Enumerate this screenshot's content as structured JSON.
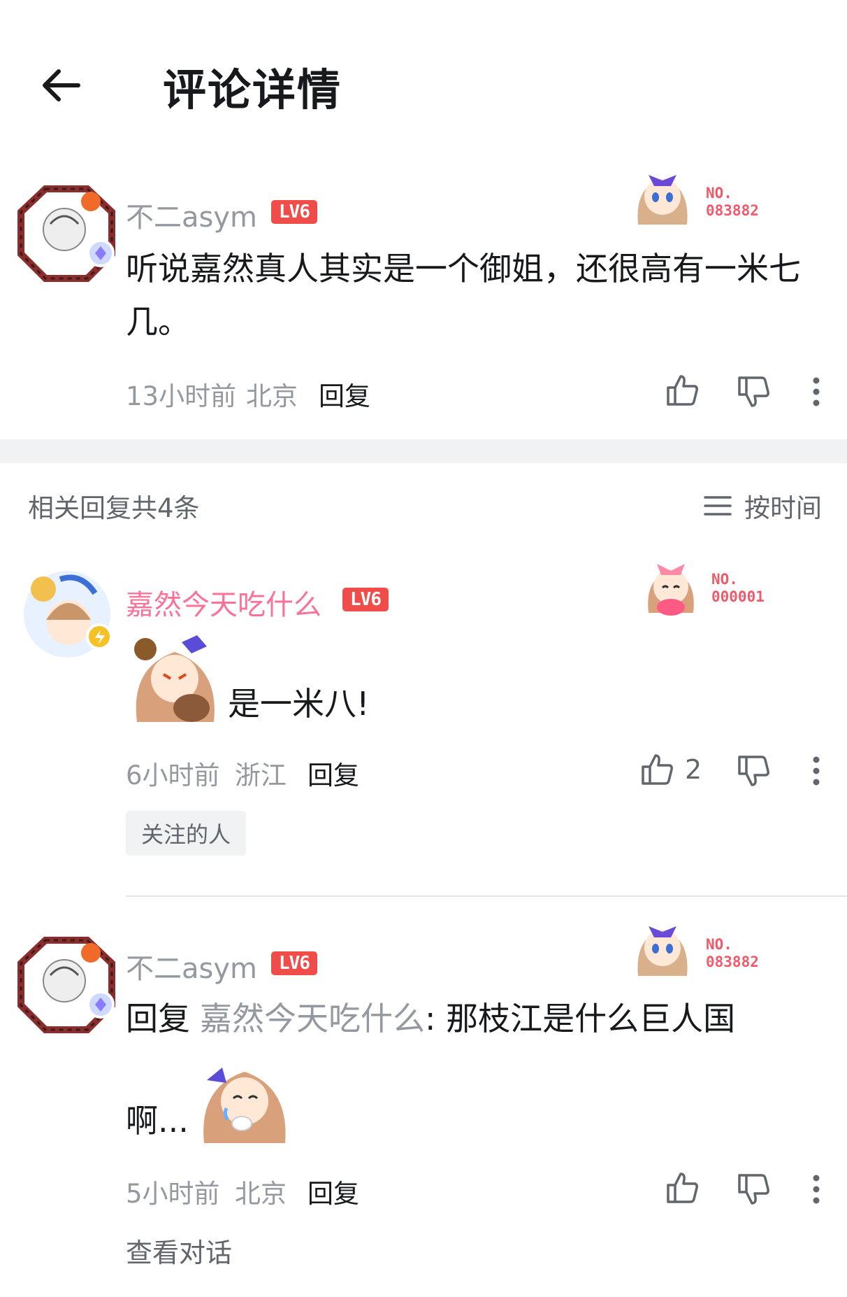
{
  "header": {
    "title": "评论详情"
  },
  "main_comment": {
    "username": "不二asym",
    "level": "LV6",
    "fan_no_label": "NO.",
    "fan_no": "083882",
    "content": "听说嘉然真人其实是一个御姐，还很高有一米七几。",
    "time": "13小时前",
    "location": "北京",
    "reply_label": "回复"
  },
  "replies_header": {
    "count_label": "相关回复共4条",
    "sort_label": "按时间"
  },
  "replies": [
    {
      "username": "嘉然今天吃什么",
      "level": "LV6",
      "fan_no_label": "NO.",
      "fan_no": "000001",
      "content": "是一米八!",
      "time": "6小时前",
      "location": "浙江",
      "reply_label": "回复",
      "like_count": "2",
      "tag": "关注的人"
    },
    {
      "username": "不二asym",
      "level": "LV6",
      "fan_no_label": "NO.",
      "fan_no": "083882",
      "reply_prefix": "回复",
      "reply_to": "嘉然今天吃什么",
      "content_a": ": 那枝江是什么巨人国",
      "content_b": "啊...",
      "time": "5小时前",
      "location": "北京",
      "reply_label": "回复",
      "view_conversation": "查看对话"
    }
  ],
  "colors": {
    "accent_pink": "#fb7299",
    "level_red": "#f04c49",
    "muted_text": "#9499a0",
    "band_gray": "#f1f2f3"
  }
}
